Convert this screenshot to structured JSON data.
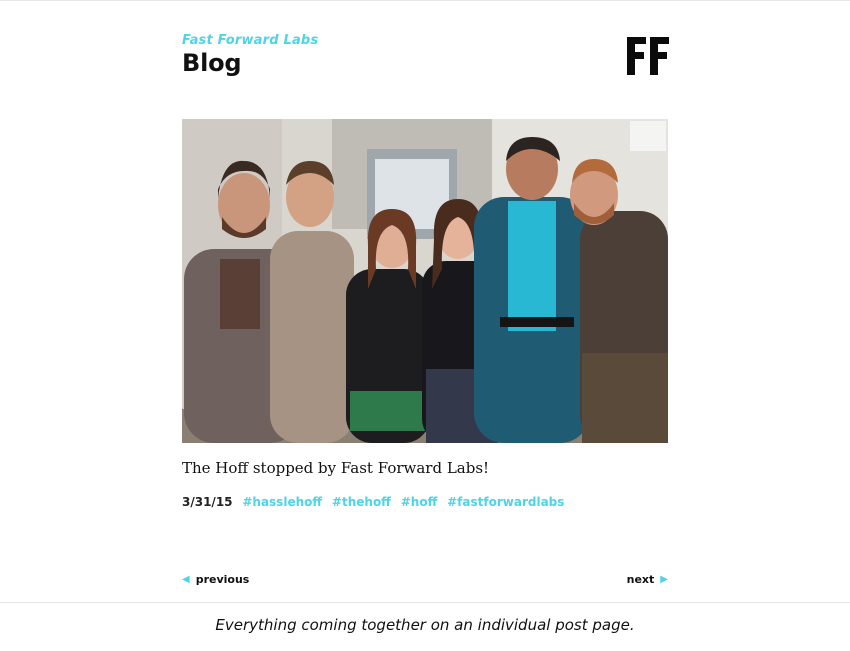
{
  "header": {
    "brand": "Fast Forward Labs",
    "section_title": "Blog",
    "logo_text": "FF"
  },
  "post": {
    "image_alt": "Group photo of six people standing together in an office",
    "title": "The Hoff stopped by Fast Forward Labs!",
    "date": "3/31/15",
    "tags": [
      "#hasslehoff",
      "#thehoff",
      "#hoff",
      "#fastforwardlabs"
    ]
  },
  "pager": {
    "previous_label": "previous",
    "next_label": "next"
  },
  "caption": "Everything coming together on an individual post page.",
  "colors": {
    "accent": "#4fd3e6",
    "text": "#111111"
  }
}
